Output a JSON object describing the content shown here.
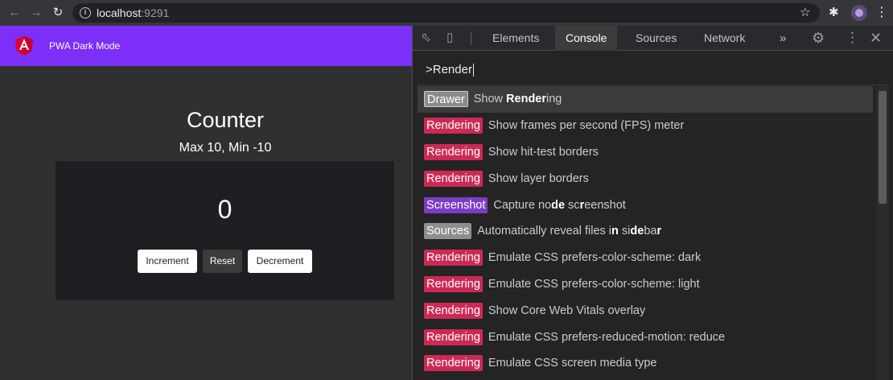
{
  "browser": {
    "back_icon": "arrow-left-icon",
    "forward_icon": "arrow-right-icon",
    "reload_icon": "reload-icon",
    "url_host": "localhost",
    "url_port": ":9291",
    "star_icon": "star-icon",
    "extensions_icon": "puzzle-icon",
    "menu_icon": "kebab-menu-icon"
  },
  "app": {
    "title": "PWA Dark Mode",
    "logo": "angular-logo",
    "toolbar_color": "#7b2ff7",
    "counter_title": "Counter",
    "counter_subtitle": "Max 10, Min -10",
    "count": "0",
    "buttons": {
      "increment": "Increment",
      "reset": "Reset",
      "decrement": "Decrement"
    }
  },
  "devtools": {
    "tabs": [
      {
        "label": "Elements",
        "active": false
      },
      {
        "label": "Console",
        "active": true
      },
      {
        "label": "Sources",
        "active": false
      },
      {
        "label": "Network",
        "active": false
      }
    ],
    "more_tabs": "»",
    "command_input": ">Render",
    "commands": [
      {
        "category": "Drawer",
        "kind": "drawer",
        "parts": [
          [
            "Show ",
            false
          ],
          [
            "Render",
            true
          ],
          [
            "ing",
            false
          ]
        ],
        "selected": true
      },
      {
        "category": "Rendering",
        "kind": "rendering",
        "parts": [
          [
            "Show frames per second (FPS) meter",
            false
          ]
        ]
      },
      {
        "category": "Rendering",
        "kind": "rendering",
        "parts": [
          [
            "Show hit-test borders",
            false
          ]
        ]
      },
      {
        "category": "Rendering",
        "kind": "rendering",
        "parts": [
          [
            "Show layer borders",
            false
          ]
        ]
      },
      {
        "category": "Screenshot",
        "kind": "screenshot",
        "parts": [
          [
            "Capture no",
            false
          ],
          [
            "de",
            true
          ],
          [
            " sc",
            false
          ],
          [
            "r",
            true
          ],
          [
            "eenshot",
            false
          ]
        ]
      },
      {
        "category": "Sources",
        "kind": "sources",
        "parts": [
          [
            "Automatically reveal files i",
            false
          ],
          [
            "n",
            true
          ],
          [
            " si",
            false
          ],
          [
            "de",
            true
          ],
          [
            "ba",
            false
          ],
          [
            "r",
            true
          ]
        ]
      },
      {
        "category": "Rendering",
        "kind": "rendering",
        "parts": [
          [
            "Emulate CSS prefers-color-scheme: dark",
            false
          ]
        ]
      },
      {
        "category": "Rendering",
        "kind": "rendering",
        "parts": [
          [
            "Emulate CSS prefers-color-scheme: light",
            false
          ]
        ]
      },
      {
        "category": "Rendering",
        "kind": "rendering",
        "parts": [
          [
            "Show Core Web Vitals overlay",
            false
          ]
        ]
      },
      {
        "category": "Rendering",
        "kind": "rendering",
        "parts": [
          [
            "Emulate CSS prefers-reduced-motion: reduce",
            false
          ]
        ]
      },
      {
        "category": "Rendering",
        "kind": "rendering",
        "parts": [
          [
            "Emulate CSS screen media type",
            false
          ]
        ]
      }
    ],
    "colors": {
      "rendering": "#cc2a55",
      "screenshot": "#7d3cc8",
      "drawer": "#8a8b8d",
      "sources": "#8e8f91"
    }
  }
}
